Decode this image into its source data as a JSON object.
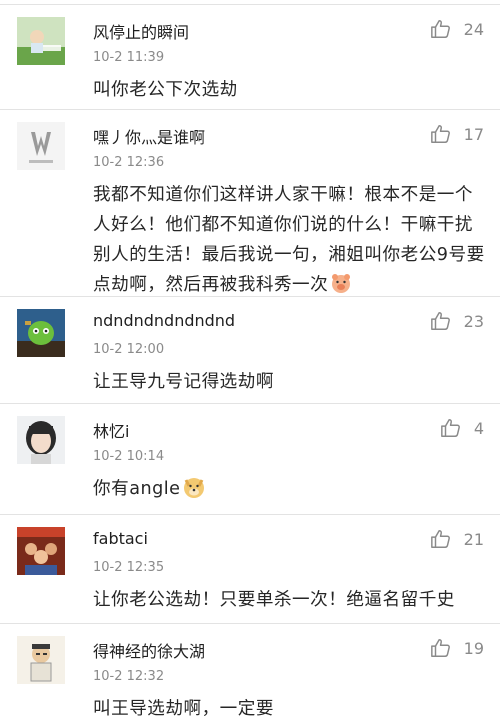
{
  "comments": [
    {
      "name": "风停止的瞬间",
      "time": "10-2 11:39",
      "likes": "24",
      "text": "叫你老公下次选劫",
      "avatar": "green-field-avatar"
    },
    {
      "name": "嘿丿你灬是谁啊",
      "time": "10-2 12:36",
      "likes": "17",
      "text": "我都不知道你们这样讲人家干嘛！根本不是一个人好么！他们都不知道你们说的什么！干嘛干扰别人的生活！最后我说一句，湘姐叫你老公9号要点劫啊，然后再被我科秀一次",
      "avatar": "w-motors-logo-avatar",
      "emoji": "pig-emoji"
    },
    {
      "name": "ndndndndndndnd",
      "time": "10-2 12:00",
      "likes": "23",
      "text": "让王导九号记得选劫啊",
      "avatar": "green-character-avatar"
    },
    {
      "name": "林忆i",
      "time": "10-2 10:14",
      "likes": "4",
      "text": "你有angle",
      "avatar": "girl-portrait-avatar",
      "emoji": "doge-emoji"
    },
    {
      "name": "fabtaci",
      "time": "10-2 12:35",
      "likes": "21",
      "text": "让你老公选劫！只要单杀一次！绝逼名留千史",
      "avatar": "movie-poster-avatar"
    },
    {
      "name": "得神经的徐大湖",
      "time": "10-2 12:32",
      "likes": "19",
      "text": "叫王导选劫啊，一定要",
      "avatar": "cartoon-man-avatar"
    }
  ],
  "colors": {
    "divider": "#e3e3e3",
    "meta": "#8a8a8a",
    "text": "#262626"
  }
}
